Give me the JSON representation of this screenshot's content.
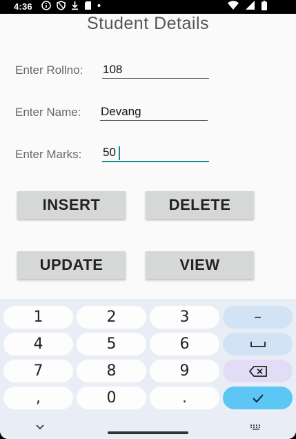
{
  "status_bar": {
    "time": "4:36",
    "left_icons": [
      "info-icon",
      "shield-icon",
      "download-icon",
      "sd-card-icon",
      "dot-icon"
    ],
    "right_icons": [
      "wifi-icon",
      "signal-icon",
      "battery-icon"
    ]
  },
  "page": {
    "title": "Student Details"
  },
  "form": {
    "rollno": {
      "label": "Enter Rollno:",
      "value": "108"
    },
    "name": {
      "label": "Enter Name:",
      "value": "Devang"
    },
    "marks": {
      "label": "Enter Marks:",
      "value": "50"
    }
  },
  "buttons": {
    "insert": "INSERT",
    "delete": "DELETE",
    "update": "UPDATE",
    "view": "VIEW"
  },
  "keyboard": {
    "keys": [
      "1",
      "2",
      "3",
      "–",
      "4",
      "5",
      "6",
      "␣",
      "7",
      "8",
      "9",
      "⌫",
      ",",
      "0",
      ".",
      "✓"
    ],
    "function_icons": [
      "minus-key",
      "space-key",
      "backspace-key",
      "done-key"
    ],
    "colors": {
      "background": "#e9eef6",
      "function_key": "#d2e3f5",
      "backspace_key": "#e2dcf7",
      "done_key": "#5cc6f4"
    }
  },
  "nav_bar": {
    "icons": [
      "chevron-down-icon",
      "keyboard-icon"
    ]
  },
  "colors": {
    "accent": "#1b8a85",
    "button_bg": "#d6d7d7",
    "title_text": "#555555"
  }
}
